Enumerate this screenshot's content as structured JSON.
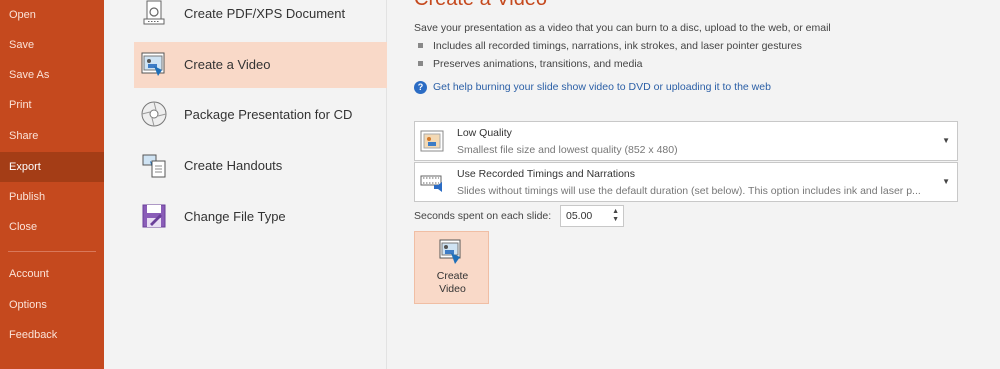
{
  "sidebar": {
    "items": [
      {
        "label": "Open"
      },
      {
        "label": "Save"
      },
      {
        "label": "Save As"
      },
      {
        "label": "Print"
      },
      {
        "label": "Share"
      },
      {
        "label": "Export"
      },
      {
        "label": "Publish"
      },
      {
        "label": "Close"
      },
      {
        "label": "Account"
      },
      {
        "label": "Options"
      },
      {
        "label": "Feedback"
      }
    ],
    "active": "Export"
  },
  "export_options": [
    {
      "label": "Create PDF/XPS Document",
      "icon": "pdf-document-icon"
    },
    {
      "label": "Create a Video",
      "icon": "video-icon"
    },
    {
      "label": "Package Presentation for CD",
      "icon": "cd-icon"
    },
    {
      "label": "Create Handouts",
      "icon": "handouts-icon"
    },
    {
      "label": "Change File Type",
      "icon": "file-type-icon"
    }
  ],
  "panel": {
    "title": "Create a Video",
    "description": "Save your presentation as a video that you can burn to a disc, upload to the web, or email",
    "bullets": [
      "Includes all recorded timings, narrations, ink strokes, and laser pointer gestures",
      "Preserves animations, transitions, and media"
    ],
    "help_link": "Get help burning your slide show video to DVD or uploading it to the web",
    "quality": {
      "main": "Low Quality",
      "sub": "Smallest file size and lowest quality (852 x 480)"
    },
    "timings": {
      "main": "Use Recorded Timings and Narrations",
      "sub": "Slides without timings will use the default duration (set below). This option includes ink and laser p..."
    },
    "seconds_label": "Seconds spent on each slide:",
    "seconds_value": "05.00",
    "create_button": {
      "line1": "Create",
      "line2": "Video"
    }
  },
  "colors": {
    "sidebar_bg": "#c5491e",
    "sidebar_active": "#a43d16",
    "selection": "#f9d9c8",
    "accent_title": "#c5491e",
    "link": "#2b5fa6"
  }
}
